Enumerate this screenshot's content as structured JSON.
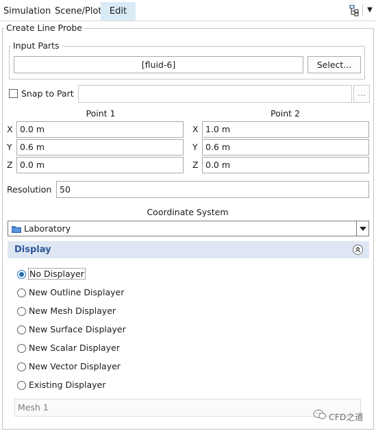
{
  "tabs": [
    {
      "label": "Simulation",
      "active": false
    },
    {
      "label": "Scene/Plot",
      "active": false
    },
    {
      "label": "Edit",
      "active": true
    }
  ],
  "toolbar_icons": [
    "tree-hierarchy-icon",
    "dropdown-arrow-icon"
  ],
  "panel": {
    "title": "Create Line Probe",
    "input_parts": {
      "legend": "Input Parts",
      "value": "[fluid-6]",
      "select_button": "Select..."
    },
    "snap_to_part": {
      "label": "Snap to Part",
      "checked": false,
      "value": "",
      "browse_label": "..."
    },
    "point1": {
      "title": "Point 1",
      "x_label": "X",
      "x": "0.0 m",
      "y_label": "Y",
      "y": "0.6 m",
      "z_label": "Z",
      "z": "0.0 m"
    },
    "point2": {
      "title": "Point 2",
      "x_label": "X",
      "x": "1.0 m",
      "y_label": "Y",
      "y": "0.6 m",
      "z_label": "Z",
      "z": "0.0 m"
    },
    "resolution": {
      "label": "Resolution",
      "value": "50"
    },
    "coordinate_system": {
      "label": "Coordinate System",
      "value": "Laboratory",
      "icon": "folder-icon"
    },
    "display": {
      "title": "Display",
      "collapse_icon": "double-chevron-up-icon",
      "options": [
        {
          "label": "No Displayer",
          "selected": true
        },
        {
          "label": "New Outline Displayer",
          "selected": false
        },
        {
          "label": "New Mesh Displayer",
          "selected": false
        },
        {
          "label": "New Surface Displayer",
          "selected": false
        },
        {
          "label": "New Scalar Displayer",
          "selected": false
        },
        {
          "label": "New Vector Displayer",
          "selected": false
        },
        {
          "label": "Existing Displayer",
          "selected": false
        }
      ],
      "existing_value": "Mesh 1"
    }
  },
  "watermark": {
    "text": "CFD之道",
    "icon": "wechat-icon"
  },
  "colors": {
    "active_tab": "#d9ecf6",
    "section_header": "#dfe6f3",
    "section_title": "#2b5797",
    "radio_selected": "#1f6fb5"
  }
}
